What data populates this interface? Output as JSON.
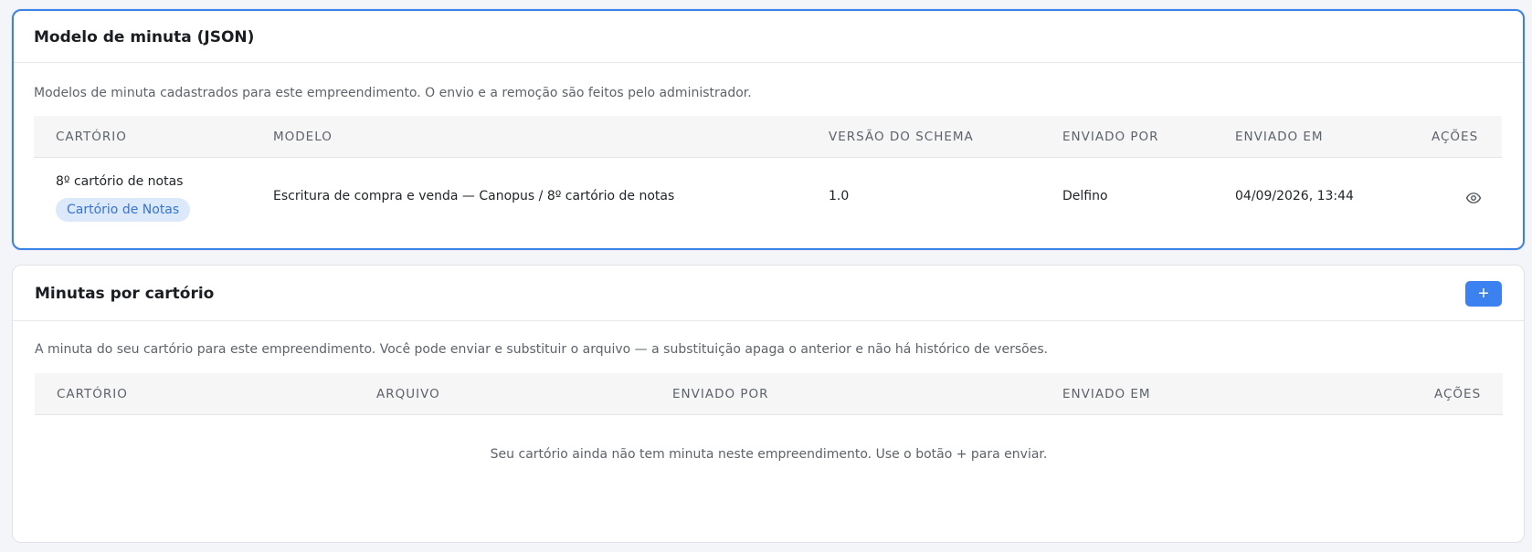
{
  "card1": {
    "title": "Modelo de minuta (JSON)",
    "description": "Modelos de minuta cadastrados para este empreendimento. O envio e a remoção são feitos pelo administrador.",
    "columns": {
      "cartorio": "CARTÓRIO",
      "modelo": "MODELO",
      "versao": "VERSÃO DO SCHEMA",
      "enviado_por": "ENVIADO POR",
      "enviado_em": "ENVIADO EM",
      "acoes": "AÇÕES"
    },
    "rows": [
      {
        "cartorio": "8º cartório de notas",
        "badge": "Cartório de Notas",
        "modelo": "Escritura de compra e venda — Canopus / 8º cartório de notas",
        "versao": "1.0",
        "enviado_por": "Delfino",
        "enviado_em": "04/09/2026, 13:44",
        "action_icon": "eye-icon"
      }
    ]
  },
  "card2": {
    "title": "Minutas por cartório",
    "add_label": "+",
    "description": "A minuta do seu cartório para este empreendimento. Você pode enviar e substituir o arquivo — a substituição apaga o anterior e não há histórico de versões.",
    "columns": {
      "cartorio": "CARTÓRIO",
      "arquivo": "ARQUIVO",
      "enviado_por": "ENVIADO POR",
      "enviado_em": "ENVIADO EM",
      "acoes": "AÇÕES"
    },
    "empty": "Seu cartório ainda não tem minuta neste empreendimento. Use o botão + para enviar."
  },
  "colors": {
    "accent": "#3b82f0",
    "active_border": "#3b82e6",
    "badge_bg": "#dce9fb",
    "badge_text": "#3573d8"
  }
}
